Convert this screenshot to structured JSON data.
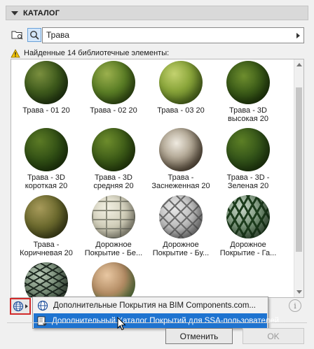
{
  "header": {
    "title": "КАТАЛОГ"
  },
  "search": {
    "value": "Трава"
  },
  "status": {
    "text": "Найденные 14 библиотечные элементы:"
  },
  "items": [
    {
      "label": "Трава - 01 20",
      "style": "radial-gradient(circle at 35% 30%, #7a8f3e 0%, #3e5a1c 45%, #1f3510 85%, #172a0c 100%)"
    },
    {
      "label": "Трава - 02 20",
      "style": "radial-gradient(circle at 35% 30%, #9bb04d 0%, #5a7d25 45%, #2f4a12 85%, #1c2f0b 100%)"
    },
    {
      "label": "Трава - 03 20",
      "style": "radial-gradient(circle at 35% 30%, #c3d26f 0%, #8ba63b 40%, #4f6d1d 80%, #2b3f0f 100%)"
    },
    {
      "label": "Трава - 3D высокая 20",
      "style": "radial-gradient(circle at 40% 35%, #6e8e2e 0%, #3b5b18 45%, #203a0c 80%, #142608 100%)"
    },
    {
      "label": "Трава - 3D короткая 20",
      "style": "radial-gradient(circle at 35% 30%, #5b7a25 0%, #2f4d14 50%, #1a300a 100%)"
    },
    {
      "label": "Трава - 3D средняя 20",
      "style": "radial-gradient(circle at 35% 30%, #6d8c2c 0%, #3a5816 50%, #1e3409 100%)"
    },
    {
      "label": "Трава - Заснеженная 20",
      "style": "radial-gradient(circle at 40% 35%, #efeae0 0%, #b7ad9b 35%, #6b5e4c 70%, #3b3226 100%)"
    },
    {
      "label": "Трава - 3D - Зеленая 20",
      "style": "radial-gradient(circle at 35% 30%, #5c7f25 0%, #305018 50%, #18300a 100%)"
    },
    {
      "label": "Трава - Коричневая 20",
      "style": "radial-gradient(circle at 35% 30%, #a79a5a 0%, #6c6a2e 45%, #3e4018 85%, #262a0e 100%)"
    },
    {
      "label": "Дорожное Покрытие - Бе...",
      "style": "repeating-linear-gradient(0deg, #8c8c7c 0 2px, transparent 2px 13px), repeating-linear-gradient(90deg, #8c8c7c 0 2px, transparent 2px 20px), radial-gradient(circle at 35% 30%, #f2f0e3 0%, #cfccb7 50%, #8e8b77 100%)"
    },
    {
      "label": "Дорожное Покрытие - Бу...",
      "style": "repeating-linear-gradient(45deg, #6d6d6d 0 2px, transparent 2px 12px), repeating-linear-gradient(-45deg, #6d6d6d 0 2px, transparent 2px 12px), radial-gradient(circle at 35% 30%, #e9e9e9 0%, #b8b8b8 50%, #6e6e6e 100%)"
    },
    {
      "label": "Дорожное Покрытие - Га...",
      "style": "repeating-linear-gradient(60deg, #1d3d1d 0 3px, transparent 3px 11px), repeating-linear-gradient(-60deg, #1d3d1d 0 3px, transparent 3px 11px), radial-gradient(circle at 35% 30%, #c7d7c7 0%, #6e8a6e 50%, #2c472c 100%)"
    },
    {
      "label": "",
      "style": "repeating-linear-gradient(30deg, #1f2b22 0 2px, transparent 2px 9px), repeating-linear-gradient(-30deg, #1f2b22 0 2px, transparent 2px 9px), radial-gradient(circle at 35% 30%, #b9c9b7 0%, #6a7f6a 50%, #2c3a2c 100%)"
    },
    {
      "label": "",
      "style": "radial-gradient(circle at 35% 30%, #e8c7a2 0%, #b28b63 45%, #6e8a4d 75%, #3e4f26 100%)"
    }
  ],
  "menu": {
    "item1": "Дополнительные Покрытия на BIM Components.com...",
    "item2": "Дополнительный Каталог Покрытий для SSA-пользователей..."
  },
  "buttons": {
    "cancel": "Отменить",
    "ok": "OK"
  },
  "colors": {
    "highlight": "#1e73d0",
    "redFrame": "#d22b2b",
    "warnYellow": "#f4c400"
  }
}
